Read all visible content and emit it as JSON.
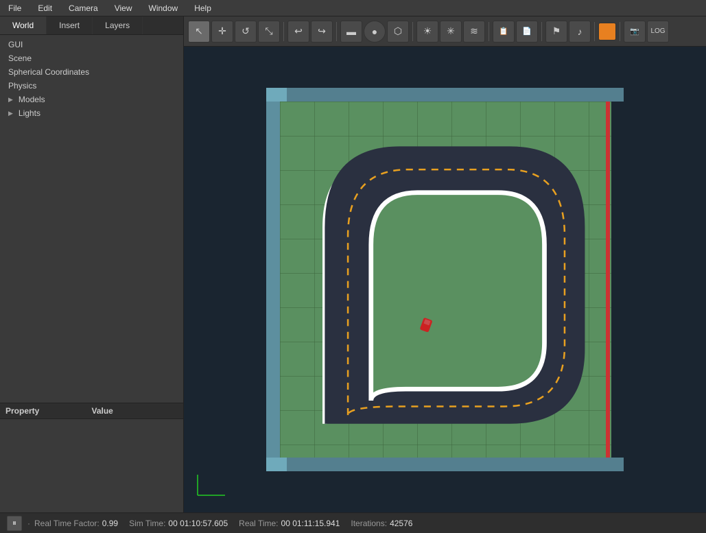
{
  "menubar": {
    "items": [
      "File",
      "Edit",
      "Camera",
      "View",
      "Window",
      "Help"
    ]
  },
  "tabs": {
    "items": [
      "World",
      "Insert",
      "Layers"
    ],
    "active": "World"
  },
  "tree": {
    "items": [
      {
        "label": "GUI",
        "hasArrow": false
      },
      {
        "label": "Scene",
        "hasArrow": false
      },
      {
        "label": "Spherical Coordinates",
        "hasArrow": false
      },
      {
        "label": "Physics",
        "hasArrow": false
      },
      {
        "label": "Models",
        "hasArrow": true
      },
      {
        "label": "Lights",
        "hasArrow": true
      }
    ]
  },
  "property_panel": {
    "col1": "Property",
    "col2": "Value"
  },
  "toolbar": {
    "buttons": [
      {
        "icon": "↖",
        "name": "select-tool",
        "active": true
      },
      {
        "icon": "✛",
        "name": "translate-tool",
        "active": false
      },
      {
        "icon": "↺",
        "name": "rotate-tool",
        "active": false
      },
      {
        "icon": "⤡",
        "name": "scale-tool",
        "active": false
      },
      {
        "icon": "↩",
        "name": "undo",
        "active": false
      },
      {
        "icon": "↪",
        "name": "redo",
        "active": false
      },
      {
        "icon": "▬",
        "name": "box-shape",
        "active": false
      },
      {
        "icon": "●",
        "name": "sphere-shape",
        "active": false
      },
      {
        "icon": "⬡",
        "name": "cylinder-shape",
        "active": false
      },
      {
        "icon": "☀",
        "name": "point-light",
        "active": false
      },
      {
        "icon": "✳",
        "name": "spot-light",
        "active": false
      },
      {
        "icon": "≋",
        "name": "directional-light",
        "active": false
      },
      {
        "icon": "📋",
        "name": "copy",
        "active": false
      },
      {
        "icon": "📄",
        "name": "paste",
        "active": false
      },
      {
        "icon": "⚑",
        "name": "flag",
        "active": false
      },
      {
        "icon": "🔊",
        "name": "audio",
        "active": false
      },
      {
        "icon": "📷",
        "name": "screenshot",
        "active": false
      },
      {
        "icon": "📊",
        "name": "log",
        "active": false
      }
    ],
    "orange_btn": "■"
  },
  "statusbar": {
    "pause_icon": "⏸",
    "realtime_factor_label": "Real Time Factor:",
    "realtime_factor_value": "0.99",
    "sim_time_label": "Sim Time:",
    "sim_time_value": "00 01:10:57.605",
    "real_time_label": "Real Time:",
    "real_time_value": "00 01:11:15.941",
    "iterations_label": "Iterations:",
    "iterations_value": "42576"
  }
}
